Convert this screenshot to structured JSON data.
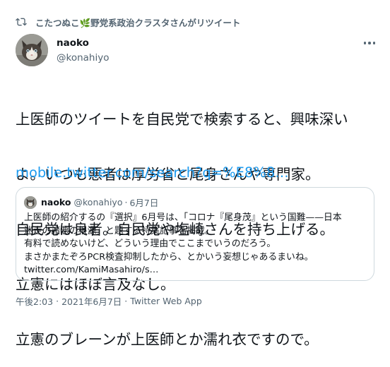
{
  "retweet": {
    "text": "こたつぬこ🌿野党系政治クラスタさんがリツイート",
    "icon": "retweet-icon"
  },
  "author": {
    "name": "naoko",
    "handle": "@konahiyo",
    "avatar_icon": "cat-avatar-icon"
  },
  "tweet": {
    "lines": [
      "上医師のツイートを自民党で検索すると、興味深い",
      "よ。いつも悪者は厚労省と尾身さんや専門家。",
      "自民党は良者。自民党や塩崎さんを持ち上げる。",
      "立憲にはほぼ言及なし。",
      "立憲のブレーンが上医師とか濡れ衣ですので。"
    ],
    "link": "mobile.twitter.com/search?q=%E8%8…"
  },
  "quote": {
    "name": "naoko",
    "handle": "@konahiyo",
    "dot": "·",
    "date": "6月7日",
    "lines": [
      "上医師の紹介するの『選択』6月号は、「コロナ『尾身茂』という国難——日本",
      "迷走の諸悪の根源」と題する特集記事を掲載。",
      "有料で読めないけど、どういう理由でここまでいうのだろう。",
      "まさかまたぞろPCR検査抑制したから、とかいう妄想じゃあるまいね。",
      "twitter.com/KamiMasahiro/s…"
    ]
  },
  "footer": {
    "time": "午後2:03",
    "sep": "·",
    "date": "2021年6月7日",
    "sep2": "·",
    "source": "Twitter Web App"
  },
  "colors": {
    "text": "#0f1419",
    "secondary": "#536471",
    "link": "#1d9bf0",
    "border": "#cfd9de"
  }
}
